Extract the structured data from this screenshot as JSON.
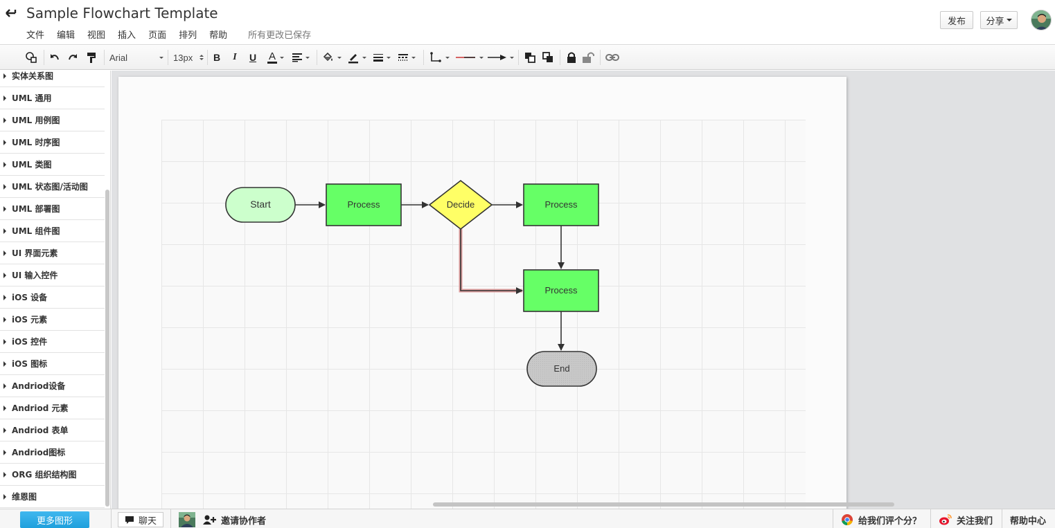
{
  "header": {
    "title": "Sample Flowchart Template",
    "menu": [
      "文件",
      "编辑",
      "视图",
      "插入",
      "页面",
      "排列",
      "帮助"
    ],
    "save_status": "所有更改已保存",
    "publish_label": "发布",
    "share_label": "分享"
  },
  "toolbar": {
    "font_family": "Arial",
    "font_size": "13px",
    "bold_label": "B",
    "italic_label": "I",
    "underline_label": "U",
    "font_color_label": "A",
    "icons": [
      "shape-search-icon",
      "undo-icon",
      "redo-icon",
      "format-painter-icon",
      "bold-icon",
      "italic-icon",
      "underline-icon",
      "font-color-icon",
      "text-align-icon",
      "fill-color-icon",
      "line-color-icon",
      "line-width-icon",
      "line-style-icon",
      "connector-type-icon",
      "start-arrow-icon",
      "end-arrow-icon",
      "bring-front-icon",
      "send-back-icon",
      "lock-icon",
      "unlock-icon",
      "link-icon"
    ]
  },
  "sidebar": {
    "categories": [
      "实体关系图",
      "UML 通用",
      "UML 用例图",
      "UML 时序图",
      "UML 类图",
      "UML 状态图/活动图",
      "UML 部署图",
      "UML 组件图",
      "UI 界面元素",
      "UI 输入控件",
      "iOS 设备",
      "iOS 元素",
      "iOS 控件",
      "iOS 图标",
      "Andriod设备",
      "Andriod 元素",
      "Andriod 表单",
      "Andriod图标",
      "ORG 组织结构图",
      "维恩图"
    ]
  },
  "diagram": {
    "nodes": {
      "start": {
        "label": "Start",
        "shape": "terminator",
        "fill": "#ccffcc"
      },
      "process1": {
        "label": "Process",
        "shape": "process",
        "fill": "#66ff66"
      },
      "decide": {
        "label": "Decide",
        "shape": "decision",
        "fill": "#ffff66"
      },
      "process2": {
        "label": "Process",
        "shape": "process",
        "fill": "#66ff66"
      },
      "process3": {
        "label": "Process",
        "shape": "process",
        "fill": "#66ff66"
      },
      "end": {
        "label": "End",
        "shape": "terminator",
        "fill": "#cccccc"
      }
    },
    "edges": [
      {
        "from": "start",
        "to": "process1"
      },
      {
        "from": "process1",
        "to": "decide"
      },
      {
        "from": "decide",
        "to": "process2"
      },
      {
        "from": "process2",
        "to": "process3"
      },
      {
        "from": "decide",
        "to": "process3",
        "selected": true
      },
      {
        "from": "process3",
        "to": "end"
      }
    ]
  },
  "footer": {
    "more_shapes_label": "更多图形",
    "chat_label": "聊天",
    "invite_label": "邀请协作者",
    "rate_label": "给我们评个分？",
    "follow_label": "关注我们",
    "help_label": "帮助中心"
  },
  "colors": {
    "accent": "#1fa0dc",
    "selected_edge": "#e0a0a0",
    "canvas_bg": "#e0e1e3"
  }
}
